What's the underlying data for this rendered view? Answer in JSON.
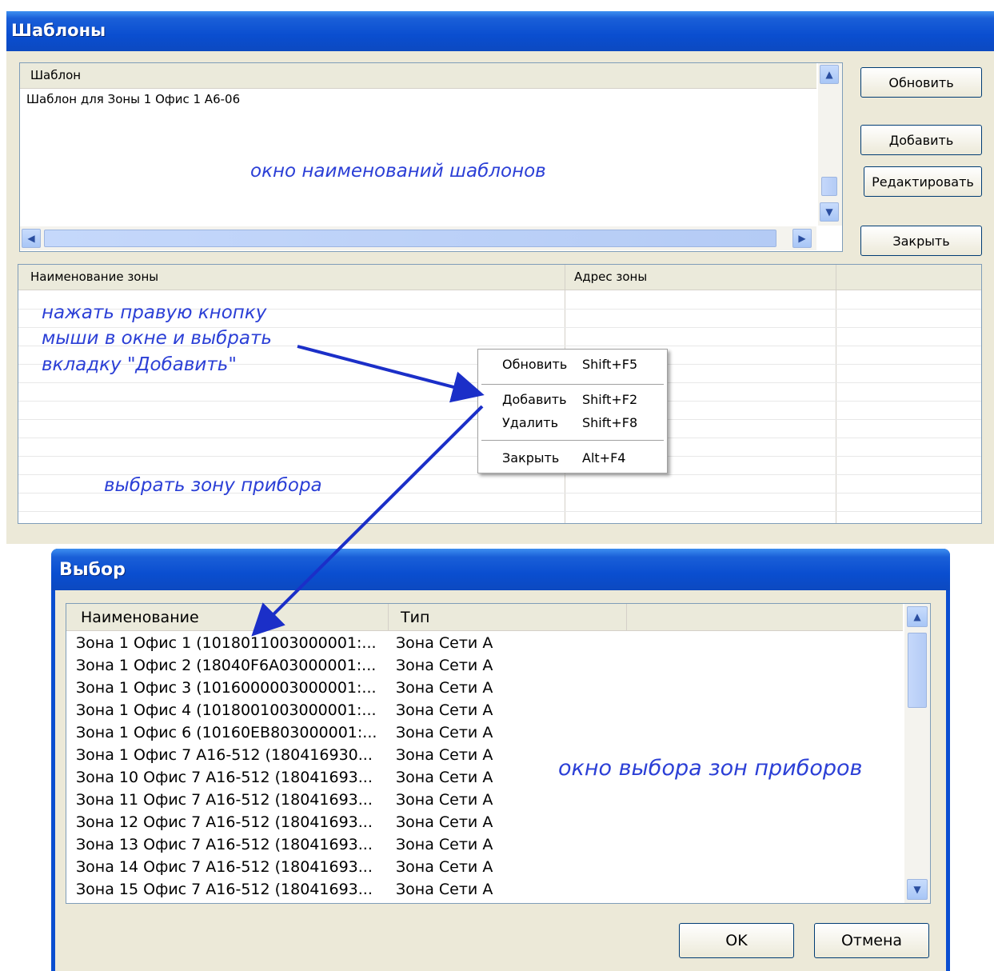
{
  "window1": {
    "title": "Шаблоны",
    "templates": {
      "header": "Шаблон",
      "rows": [
        "Шаблон для Зоны 1 Офис 1 А6-06"
      ],
      "annotation": "окно наименований шаблонов"
    },
    "buttons": {
      "refresh": "Обновить",
      "add": "Добавить",
      "edit": "Редактировать",
      "close": "Закрыть"
    },
    "zones": {
      "columns": [
        "Наименование зоны",
        "Адрес зоны"
      ]
    },
    "context_menu": [
      {
        "label": "Обновить",
        "shortcut": "Shift+F5"
      },
      {
        "label": "Добавить",
        "shortcut": "Shift+F2"
      },
      {
        "label": "Удалить",
        "shortcut": "Shift+F8"
      },
      {
        "label": "Закрыть",
        "shortcut": "Alt+F4"
      }
    ],
    "notes": {
      "right_click_1": "нажать правую кнопку",
      "right_click_2": "мыши в окне и выбрать",
      "right_click_3": "вкладку \"Добавить\"",
      "select_zone": "выбрать зону прибора"
    }
  },
  "window2": {
    "title": "Выбор",
    "columns": [
      "Наименование",
      "Тип"
    ],
    "rows": [
      {
        "name": "Зона 1 Офис 1 (1018011003000001:...",
        "type": "Зона Сети А"
      },
      {
        "name": "Зона 1 Офис 2 (18040F6A03000001:...",
        "type": "Зона Сети А"
      },
      {
        "name": "Зона 1 Офис 3 (1016000003000001:...",
        "type": "Зона Сети А"
      },
      {
        "name": "Зона 1 Офис 4 (1018001003000001:...",
        "type": "Зона Сети А"
      },
      {
        "name": "Зона 1 Офис 6 (10160EB803000001:...",
        "type": "Зона Сети А"
      },
      {
        "name": "Зона 1 Офис 7 А16-512 (180416930...",
        "type": "Зона Сети А"
      },
      {
        "name": "Зона 10 Офис 7 А16-512 (18041693...",
        "type": "Зона Сети А"
      },
      {
        "name": "Зона 11 Офис 7 А16-512 (18041693...",
        "type": "Зона Сети А"
      },
      {
        "name": "Зона 12 Офис 7 А16-512 (18041693...",
        "type": "Зона Сети А"
      },
      {
        "name": "Зона 13 Офис 7 А16-512 (18041693...",
        "type": "Зона Сети А"
      },
      {
        "name": "Зона 14 Офис 7 А16-512 (18041693...",
        "type": "Зона Сети А"
      },
      {
        "name": "Зона 15 Офис 7 А16-512 (18041693...",
        "type": "Зона Сети А"
      }
    ],
    "annotation": "окно выбора зон приборов",
    "buttons": {
      "ok": "OK",
      "cancel": "Отмена"
    }
  },
  "colors": {
    "titlebar": "#0a4ed0",
    "dialog_bg": "#ece9d8",
    "annotation": "#2b3fd6"
  }
}
